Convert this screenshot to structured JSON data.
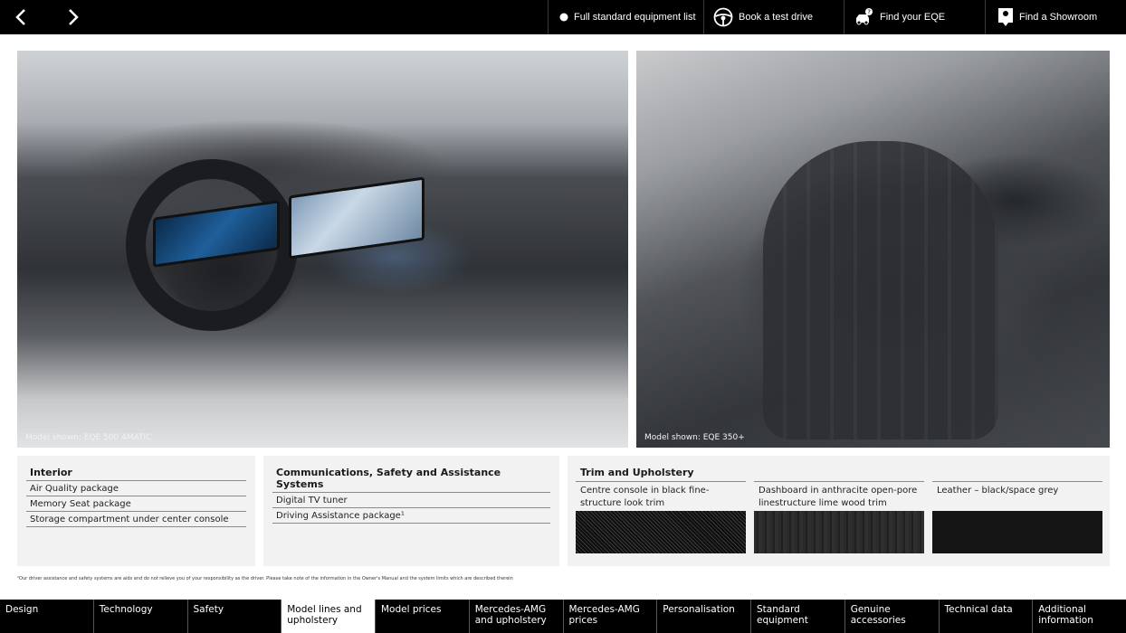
{
  "topbar": {
    "actions": [
      {
        "label": "Full standard equipment list",
        "icon": "dot-icon"
      },
      {
        "label": "Book a test drive",
        "icon": "steering-wheel-icon"
      },
      {
        "label": "Find your EQE",
        "icon": "car-search-icon"
      },
      {
        "label": "Find a Showroom",
        "icon": "location-pin-icon"
      }
    ]
  },
  "photos": {
    "left_caption": "Model shown: EQE 500 4MATIC",
    "right_caption": "Model shown: EQE 350+"
  },
  "interior": {
    "title": "Interior",
    "items": [
      "Air Quality package",
      "Memory Seat package",
      "Storage compartment under center console"
    ]
  },
  "comms": {
    "title": "Communications, Safety and Assistance Systems",
    "items": [
      "Digital TV tuner",
      "Driving Assistance package¹"
    ]
  },
  "trim": {
    "title": "Trim and Upholstery",
    "options": [
      {
        "label": "Centre console in black fine-structure look trim",
        "swatch": "#111111"
      },
      {
        "label": "Dashboard in anthracite open-pore linestructure lime wood trim",
        "swatch": "#262626"
      },
      {
        "label": "Leather – black/space grey",
        "swatch": "#141414"
      }
    ]
  },
  "footnote": "¹Our driver assistance and safety systems are aids and do not relieve you of your responsibility as the driver. Please take note of the information in the Owner's Manual and the system limits which are described therein",
  "bottom_nav": [
    {
      "label": "Design"
    },
    {
      "label": "Technology"
    },
    {
      "label": "Safety"
    },
    {
      "label": "Model lines and upholstery",
      "active": true
    },
    {
      "label": "Model prices"
    },
    {
      "label": "Mercedes-AMG and upholstery"
    },
    {
      "label": "Mercedes-AMG prices"
    },
    {
      "label": "Personalisation"
    },
    {
      "label": "Standard equipment"
    },
    {
      "label": "Genuine accessories"
    },
    {
      "label": "Technical data"
    },
    {
      "label": "Additional information"
    }
  ]
}
